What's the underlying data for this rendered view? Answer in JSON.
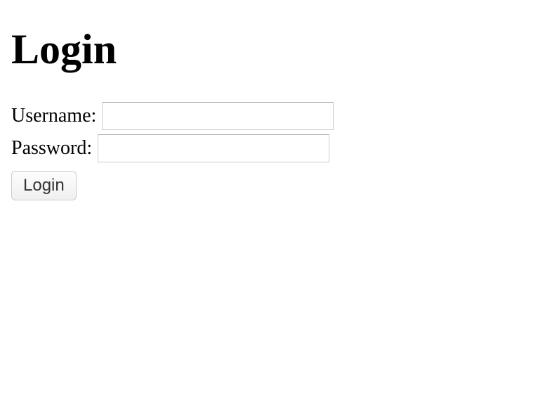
{
  "page": {
    "title": "Login"
  },
  "form": {
    "username_label": "Username:",
    "username_value": "",
    "password_label": "Password:",
    "password_value": "",
    "submit_label": "Login"
  }
}
